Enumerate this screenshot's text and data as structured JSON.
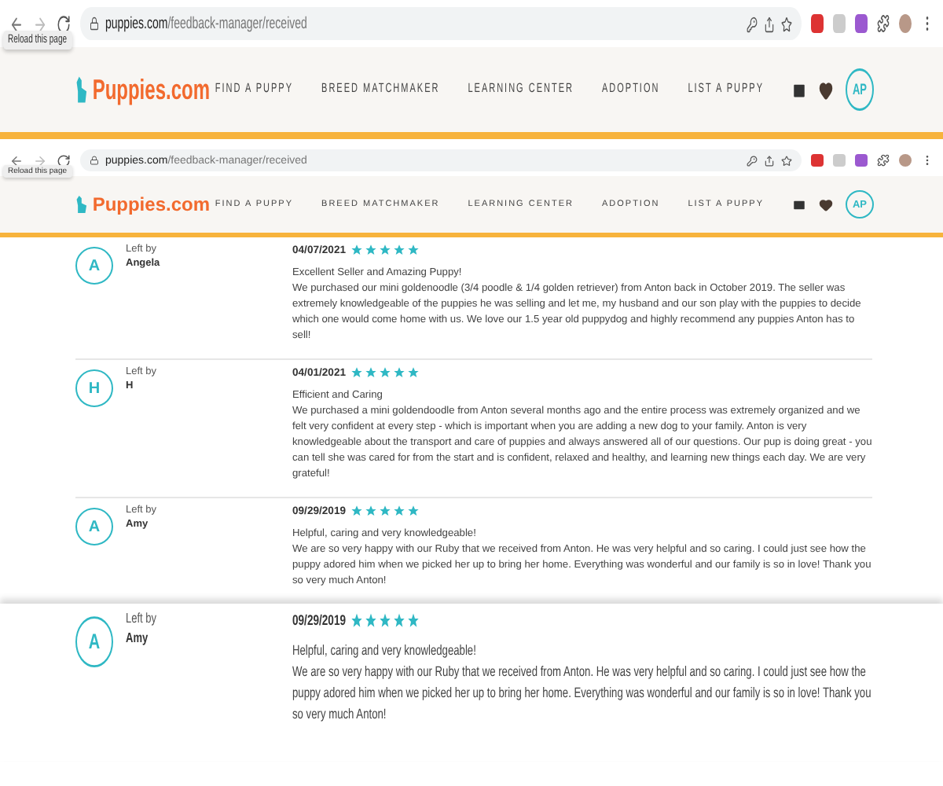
{
  "backdrop_top": {
    "browser": {
      "url_host": "puppies.com",
      "url_path": "/feedback-manager/received",
      "tooltip": "Reload this page"
    },
    "site": {
      "logo": "Puppies.com",
      "nav": [
        "FIND A PUPPY",
        "BREED MATCHMAKER",
        "LEARNING CENTER",
        "ADOPTION",
        "LIST A PUPPY"
      ],
      "avatar": "AP"
    }
  },
  "browser": {
    "url_host": "puppies.com",
    "url_path": "/feedback-manager/received",
    "tooltip": "Reload this page"
  },
  "site": {
    "logo": "Puppies.com",
    "nav": [
      "FIND A PUPPY",
      "BREED MATCHMAKER",
      "LEARNING CENTER",
      "ADOPTION",
      "LIST A PUPPY"
    ],
    "avatar": "AP"
  },
  "reviews": [
    {
      "initial": "A",
      "left_by": "Left by",
      "author": "Angela",
      "date": "04/07/2021",
      "stars": 5,
      "title": "Excellent Seller and Amazing Puppy!",
      "body": "We purchased our mini goldenoodle (3/4 poodle & 1/4 golden retriever) from Anton back in October 2019. The seller was extremely knowledgeable of the puppies he was selling and let me, my husband and our son play with the puppies to decide which one would come home with us. We love our 1.5 year old puppydog and highly recommend any puppies Anton has to sell!"
    },
    {
      "initial": "H",
      "left_by": "Left by",
      "author": "H",
      "date": "04/01/2021",
      "stars": 5,
      "title": "Efficient and Caring",
      "body": "We purchased a mini goldendoodle from Anton several months ago and the entire process was extremely organized and we felt very confident at every step - which is important when you are adding a new dog to your family. Anton is very knowledgeable about the transport and care of puppies and always answered all of our questions. Our pup is doing great - you can tell she was cared for from the start and is confident, relaxed and healthy, and learning new things each day. We are very grateful!"
    },
    {
      "initial": "A",
      "left_by": "Left by",
      "author": "Amy",
      "date": "09/29/2019",
      "stars": 5,
      "title": "Helpful, caring and very knowledgeable!",
      "body": "We are so very happy with our Ruby that we received from Anton. He was very helpful and so caring. I could just see how the puppy adored him when we picked her up to bring her home. Everything was wonderful and our family is so in love! Thank you so very much Anton!"
    }
  ],
  "backdrop_bottom": {
    "review": {
      "initial": "A",
      "left_by": "Left by",
      "author": "Amy",
      "date": "09/29/2019",
      "stars": 5,
      "title": "Helpful, caring and very knowledgeable!",
      "body": "We are so very happy with our Ruby that we received from Anton. He was very helpful and so caring. I could just see how the puppy adored him when we picked her up to bring her home. Everything was wonderful and our family is so in love! Thank you so very much Anton!"
    }
  }
}
